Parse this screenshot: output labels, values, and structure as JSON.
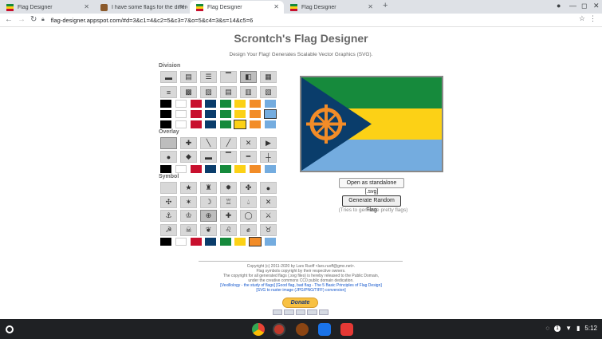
{
  "browser": {
    "tabs": [
      {
        "title": "Flag Designer",
        "active": false
      },
      {
        "title": "I have some flags for the differe...",
        "active": false
      },
      {
        "title": "Flag Designer",
        "active": true
      },
      {
        "title": "Flag Designer",
        "active": false
      }
    ],
    "new_tab": "+",
    "url": "flag-designer.appspot.com/#d=3&c1=4&c2=5&c3=7&o=5&c4=3&s=14&c5=6"
  },
  "page": {
    "title": "Scrontch's Flag Designer",
    "subtitle": "Design Your Flag! Generates Scalable Vector Graphics (SVG).",
    "sections": {
      "division": "Division",
      "overlay": "Overlay",
      "symbol": "Symbol"
    },
    "buttons": {
      "standalone": "Open as standalone [.svg]",
      "random": "Generate Random Flag"
    },
    "hint": "(Tries to generate pretty flags)",
    "footer": {
      "copyright": "Copyright (c) 2011-2020 by Lars Ruoff <lars.ruoff@gmx.net>.",
      "line2": "Flag symbols copyright by their respective owners.",
      "line3": "The copyright for all generated flags (.svg files) is hereby released to the Public Domain,",
      "line4": "under the creative commons CC0 public domain dedication.",
      "line5": "[Vexillology - the study of flags] [Good flag, bad flag - The 5 Basic Principles of Flag Design]",
      "line6": "[SVG to raster image (JPG/PNG/TIFF) conversion]"
    },
    "donate": "Donate"
  },
  "palette": [
    "#000000",
    "#ffffff",
    "#c8102e",
    "#0a3d6b",
    "#168a3c",
    "#fcd116",
    "#f28c28",
    "#74acdf"
  ],
  "flag_colors": {
    "top": "#168a3c",
    "middle": "#fcd116",
    "bottom": "#74acdf",
    "triangle": "#0a3d6b",
    "symbol": "#f28c28"
  },
  "symbol_icons": [
    "blank",
    "star-icon",
    "eagle-icon",
    "sun-icon",
    "cross-flower-icon",
    "circle-icon",
    "compass-icon",
    "star-small-icon",
    "crescent-icon",
    "tower-icon",
    "drop-icon",
    "saltire-icon",
    "anchor-icon",
    "crown-icon",
    "wheel-icon",
    "cross-icon",
    "wreath-icon",
    "swords-icon",
    "hammer-sickle-icon",
    "skull-icon",
    "leaf-icon",
    "lion-icon",
    "fist-icon",
    "bull-icon"
  ],
  "status": {
    "time": "5:12",
    "notifications": "1"
  }
}
